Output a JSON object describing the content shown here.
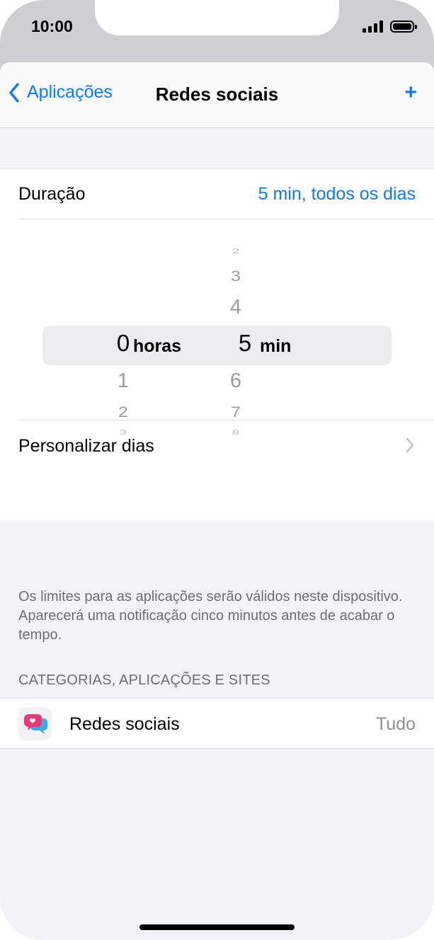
{
  "status": {
    "time": "10:00"
  },
  "nav": {
    "back_label": "Aplicações",
    "title": "Redes sociais",
    "add_label": "+"
  },
  "duration": {
    "label": "Duração",
    "value": "5 min, todos os dias"
  },
  "picker": {
    "hours": {
      "above": [],
      "selected": "0",
      "below": [
        "1",
        "2",
        "3"
      ],
      "unit": "horas"
    },
    "minutes": {
      "above": [
        "2",
        "3",
        "4"
      ],
      "selected": "5",
      "below": [
        "6",
        "7",
        "8"
      ],
      "unit": "min"
    }
  },
  "custom_days": {
    "label": "Personalizar dias"
  },
  "footnote": "Os limites para as aplicações serão válidos neste dispositivo. Aparecerá uma notificação cinco minutos antes de acabar o tempo.",
  "section": {
    "header": "CATEGORIAS, APLICAÇÕES E SITES"
  },
  "apps": [
    {
      "label": "Redes sociais",
      "value": "Tudo",
      "icon": "social-networking-icon"
    }
  ],
  "colors": {
    "accent": "#0a7aff",
    "secondary_text": "#8e8e93",
    "background": "#f2f2f7"
  }
}
